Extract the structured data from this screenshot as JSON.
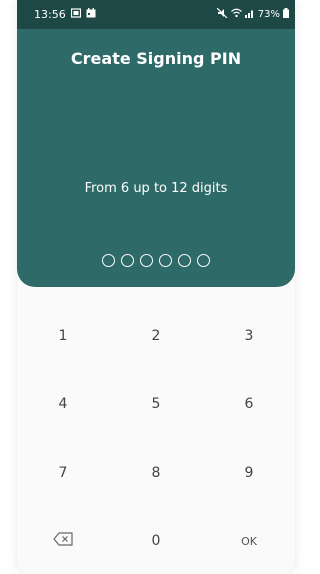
{
  "status_bar": {
    "time": "13:56",
    "left_icons": [
      "photo-icon",
      "calendar-icon"
    ],
    "right_icons": [
      "mute-icon",
      "wifi-icon",
      "signal-icon"
    ],
    "battery": "73%"
  },
  "header": {
    "title": "Create Signing PIN",
    "subtitle": "From 6 up to 12 digits",
    "pin_length_shown": 6,
    "pin_filled": 0
  },
  "keypad": {
    "keys": [
      {
        "label": "1"
      },
      {
        "label": "2"
      },
      {
        "label": "3"
      },
      {
        "label": "4"
      },
      {
        "label": "5"
      },
      {
        "label": "6"
      },
      {
        "label": "7"
      },
      {
        "label": "8"
      },
      {
        "label": "9"
      },
      {
        "icon": "backspace-icon"
      },
      {
        "label": "0"
      },
      {
        "label": "OK"
      }
    ]
  },
  "colors": {
    "status_bar": "#1d4846",
    "header": "#2e6a67",
    "keypad_bg": "#fafafa",
    "key_text": "#444444"
  }
}
